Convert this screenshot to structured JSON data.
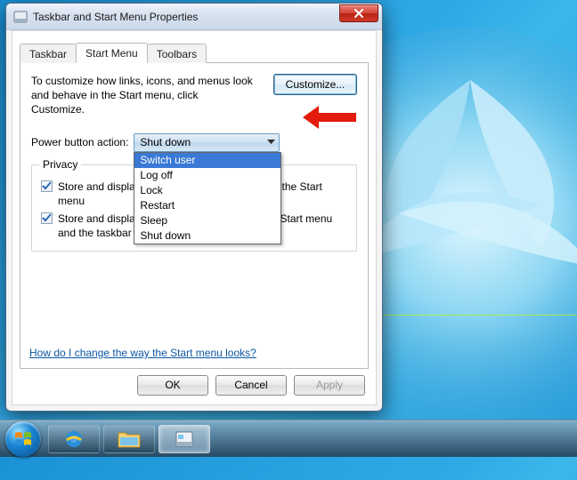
{
  "window_title": "Taskbar and Start Menu Properties",
  "tabs": {
    "taskbar": "Taskbar",
    "start_menu": "Start Menu",
    "toolbars": "Toolbars"
  },
  "instructions": "To customize how links, icons, and menus look and behave in the Start menu, click Customize.",
  "customize_label": "Customize...",
  "power_label": "Power button action:",
  "power_value": "Shut down",
  "power_options": [
    "Switch user",
    "Log off",
    "Lock",
    "Restart",
    "Sleep",
    "Shut down"
  ],
  "power_highlight_index": 0,
  "privacy_legend": "Privacy",
  "privacy_opt1": "Store and display recently opened programs in the Start menu",
  "privacy_opt2": "Store and display recently opened items in the Start menu and the taskbar",
  "help_link": "How do I change the way the Start menu looks?",
  "buttons": {
    "ok": "OK",
    "cancel": "Cancel",
    "apply": "Apply"
  }
}
